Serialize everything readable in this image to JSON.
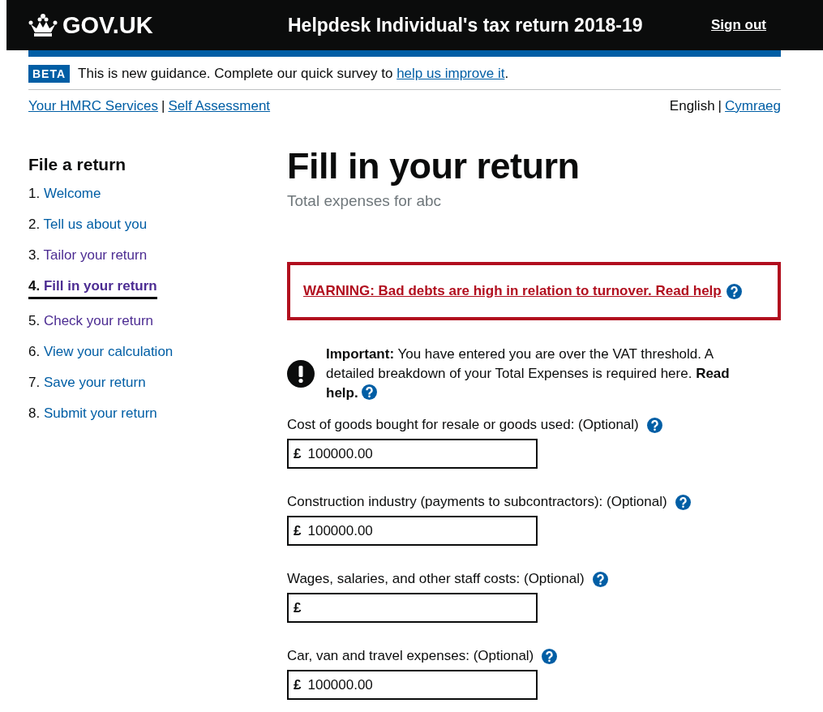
{
  "header": {
    "logo_text": "GOV.UK",
    "service_name": "Helpdesk Individual's tax return 2018-19",
    "sign_out": "Sign out"
  },
  "phase_banner": {
    "tag": "BETA",
    "text_before": "This is new guidance. Complete our quick survey to ",
    "link": "help us improve it",
    "text_after": "."
  },
  "breadcrumbs": {
    "links": [
      "Your HMRC Services",
      "Self Assessment"
    ],
    "separator": "|"
  },
  "language": {
    "current": "English",
    "separator": "|",
    "link": "Cymraeg"
  },
  "sidebar": {
    "title": "File a return",
    "items": [
      {
        "number": "1.",
        "label": "Welcome",
        "visited": false,
        "selected": false
      },
      {
        "number": "2.",
        "label": "Tell us about you",
        "visited": false,
        "selected": false
      },
      {
        "number": "3.",
        "label": "Tailor your return",
        "visited": true,
        "selected": false
      },
      {
        "number": "4.",
        "label": "Fill in your return",
        "visited": true,
        "selected": true
      },
      {
        "number": "5.",
        "label": "Check your return",
        "visited": true,
        "selected": false
      },
      {
        "number": "6.",
        "label": "View your calculation",
        "visited": false,
        "selected": false
      },
      {
        "number": "7.",
        "label": "Save your return",
        "visited": false,
        "selected": false
      },
      {
        "number": "8.",
        "label": "Submit your return",
        "visited": false,
        "selected": false
      }
    ]
  },
  "main": {
    "title": "Fill in your return",
    "caption": "Total expenses for abc",
    "warning": {
      "text": "WARNING: Bad debts are high in relation to turnover. Read help"
    },
    "important": {
      "text": "**Important:** You have entered you are over the VAT threshold. A detailed breakdown of your Total Expenses is required here. **Read help.**"
    },
    "fields": [
      {
        "label": "Cost of goods bought for resale or goods used: (Optional)",
        "prefix": "£",
        "value": "100000.00"
      },
      {
        "label": "Construction industry (payments to subcontractors): (Optional)",
        "prefix": "£",
        "value": "100000.00"
      },
      {
        "label": "Wages, salaries, and other staff costs: (Optional)",
        "prefix": "£"
      },
      {
        "label": "Car, van and travel expenses: (Optional)",
        "prefix": "£",
        "value": "100000.00"
      }
    ]
  }
}
